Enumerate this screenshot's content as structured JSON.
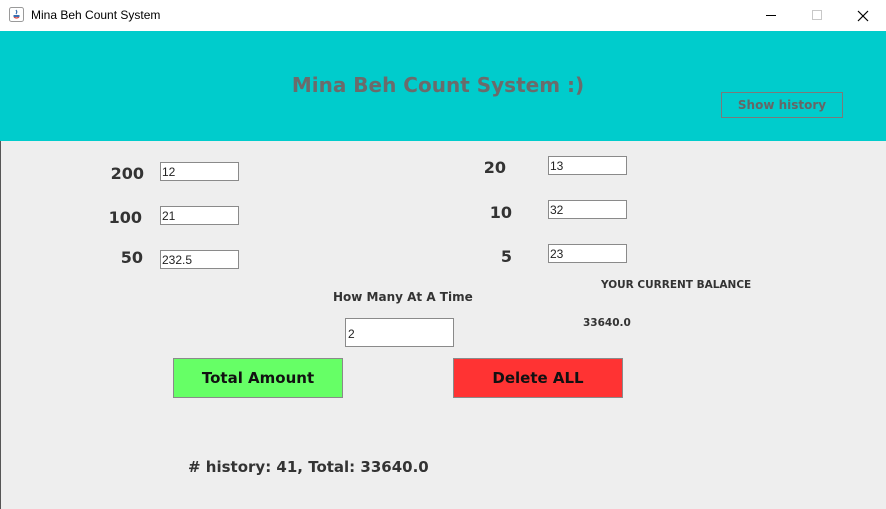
{
  "window": {
    "title": "Mina Beh Count System"
  },
  "header": {
    "title": "Mina Beh Count System :)",
    "history_button": "Show history"
  },
  "colors": {
    "header_bg": "#00cccc",
    "total_button": "#66ff66",
    "delete_button": "#ff3333"
  },
  "denominations": {
    "d200": {
      "label": "200",
      "value": "12"
    },
    "d100": {
      "label": "100",
      "value": "21"
    },
    "d50": {
      "label": "50",
      "value": "232.5"
    },
    "d20": {
      "label": "20",
      "value": "13"
    },
    "d10": {
      "label": "10",
      "value": "32"
    },
    "d5": {
      "label": "5",
      "value": "23"
    }
  },
  "at_a_time": {
    "label": "How Many At A Time",
    "value": "2"
  },
  "balance": {
    "label": "YOUR CURRENT BALANCE",
    "value": "33640.0"
  },
  "actions": {
    "total": "Total Amount",
    "delete": "Delete ALL"
  },
  "history_text": "# history: 41, Total: 33640.0"
}
